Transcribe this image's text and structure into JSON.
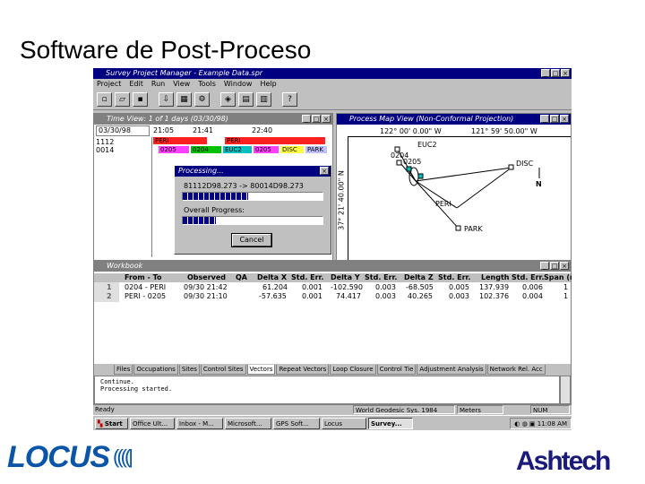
{
  "slide": {
    "title": "Software de Post-Proceso"
  },
  "app": {
    "title": "Survey Project Manager - Example Data.spr",
    "menu": [
      "Project",
      "Edit",
      "Run",
      "View",
      "Tools",
      "Window",
      "Help"
    ]
  },
  "time_view": {
    "title": "Time View: 1 of 1 days (03/30/98)",
    "date": "03/30/98",
    "ticks": [
      "21:05",
      "21:41",
      "22:40"
    ],
    "sites": [
      "1112",
      "0014"
    ],
    "row1_bars": [
      "PERI",
      "PERI"
    ],
    "row2_bars": [
      "0205",
      "0204",
      "EUC2",
      "0205",
      "DISC",
      "PARK"
    ]
  },
  "processing": {
    "title": "Processing...",
    "file_line": "81112D98.273 -> 80014D98.273",
    "progress": 0.47,
    "overall_label": "Overall Progress:",
    "overall_progress": 0.24,
    "cancel_label": "Cancel"
  },
  "map_view": {
    "title": "Process Map View (Non-Conformal Projection)",
    "lon_left": "122° 00' 0.00\" W",
    "lon_right": "121° 59' 50.00\" W",
    "lat": "37° 21' 40.00\" N",
    "points": [
      "EUC2",
      "0204",
      "0205",
      "PERI",
      "DISC",
      "PARK"
    ],
    "north": "N"
  },
  "workbook": {
    "title": "Workbook",
    "columns": [
      "From - To",
      "Observed",
      "QA",
      "Delta X",
      "Std. Err.",
      "Delta Y",
      "Std. Err.",
      "Delta Z",
      "Std. Err.",
      "Length",
      "Std. Err.",
      "Span (m"
    ],
    "rows": [
      {
        "n": "1",
        "cells": [
          "0204 - PERI",
          "09/30 21:42",
          "",
          "61.204",
          "0.001",
          "-102.590",
          "0.003",
          "-68.505",
          "0.005",
          "137.939",
          "0.006",
          "1"
        ]
      },
      {
        "n": "2",
        "cells": [
          "PERI - 0205",
          "09/30 21:10",
          "",
          "-57.635",
          "0.001",
          "74.417",
          "0.003",
          "40.265",
          "0.003",
          "102.376",
          "0.004",
          "1"
        ]
      }
    ],
    "tabs": [
      "Files",
      "Occupations",
      "Sites",
      "Control Sites",
      "Vectors",
      "Repeat Vectors",
      "Loop Closure",
      "Control Tie",
      "Adjustment Analysis",
      "Network Rel. Acc"
    ],
    "active_tab": "Vectors"
  },
  "log": {
    "lines": [
      "Continue.",
      "Processing started."
    ]
  },
  "status": {
    "ready": "Ready",
    "datum": "World Geodesic Sys. 1984",
    "units": "Meters",
    "num": "NUM"
  },
  "taskbar": {
    "start": "Start",
    "tasks": [
      "Office Ult...",
      "Inbox - M...",
      "Microsoft...",
      "GPS Soft...",
      "Locus",
      "Survey..."
    ],
    "clock": "11:08 AM"
  },
  "logos": {
    "locus": "LOCUS",
    "ashtech": "Ashtech"
  },
  "colors": {
    "titlebar": "#000080",
    "bar_red": "#ff2020",
    "bar_green": "#00c000",
    "bar_magenta": "#ff40ff",
    "bar_cyan": "#00c0c0",
    "bar_yellow": "#ffff40",
    "bar_purple": "#c0c0ff",
    "progress": "#000080",
    "map_line": "#000000",
    "logo_blue": "#0b55a8"
  }
}
